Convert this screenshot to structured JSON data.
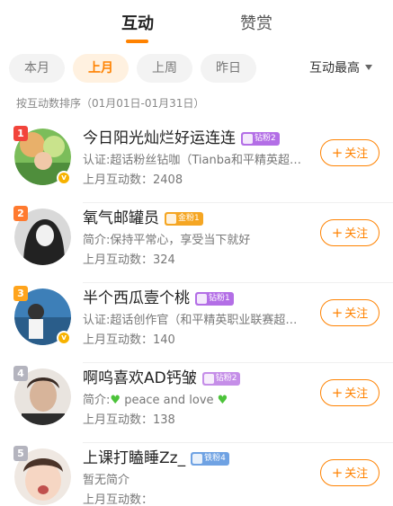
{
  "tabs": [
    {
      "label": "互动",
      "active": true
    },
    {
      "label": "赞赏",
      "active": false
    }
  ],
  "filters": [
    "本月",
    "上月",
    "上周",
    "昨日"
  ],
  "active_filter": "上月",
  "sort_label": "互动最高",
  "sort_note": "按互动数排序（01月01日-01月31日）",
  "follow_label": "关注",
  "list": [
    {
      "rank": "1",
      "name": "今日阳光灿烂好运连连",
      "badge": "钻粉2",
      "desc": "认证:超话粉丝钻咖（Tianba和平精英超…",
      "count_label": "上月互动数：2408",
      "verified": true
    },
    {
      "rank": "2",
      "name": "氧气邮罐员",
      "badge": "金粉1",
      "desc": "简介:保持平常心，享受当下就好",
      "count_label": "上月互动数：324",
      "verified": false
    },
    {
      "rank": "3",
      "name": "半个西瓜壹个桃",
      "badge": "钻粉1",
      "desc": "认证:超话创作官（和平精英职业联赛超…",
      "count_label": "上月互动数：140",
      "verified": true
    },
    {
      "rank": "4",
      "name": "啊呜喜欢AD钙皱",
      "badge": "钻粉2",
      "desc_prefix": "简介:",
      "desc_main": "peace and love",
      "count_label": "上月互动数：138",
      "verified": false
    },
    {
      "rank": "5",
      "name": "上课打瞌睡Zz_",
      "badge": "铁粉4",
      "desc": "暂无简介",
      "count_label": "上月互动数：",
      "verified": false
    }
  ],
  "colors": {
    "accent": "#ff8200",
    "rank1": "#f2443b",
    "rank2": "#ff7a2f",
    "rank3": "#ffa41c",
    "rank_other": "#b4b4be"
  }
}
